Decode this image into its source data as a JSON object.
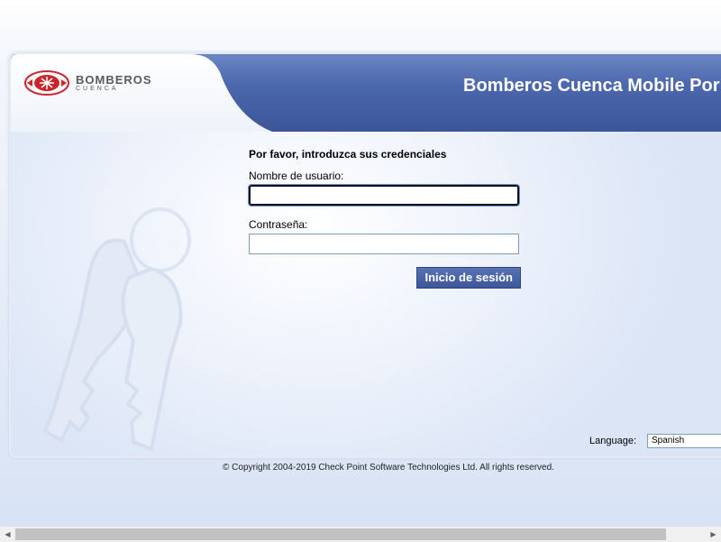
{
  "header": {
    "logo_text": "BOMBEROS",
    "logo_subtext": "CUENCA",
    "portal_title": "Bomberos Cuenca Mobile Por"
  },
  "form": {
    "heading": "Por favor, introduzca sus credenciales",
    "username_label": "Nombre de usuario:",
    "username_value": "",
    "password_label": "Contraseña:",
    "password_value": "",
    "submit_label": "Inicio de sesión"
  },
  "language": {
    "label": "Language:",
    "selected": "Spanish"
  },
  "footer": {
    "copyright": "© Copyright 2004-2019   Check Point Software Technologies Ltd. All rights reserved."
  },
  "colors": {
    "header_blue": "#4c68ad",
    "button_blue": "#4a64a6",
    "logo_red": "#c8282d"
  },
  "icons": {
    "logo": "fire-department-emblem-icon",
    "background": "keys-watermark-icon",
    "scroll_left": "arrow-left-icon",
    "scroll_right": "arrow-right-icon"
  }
}
